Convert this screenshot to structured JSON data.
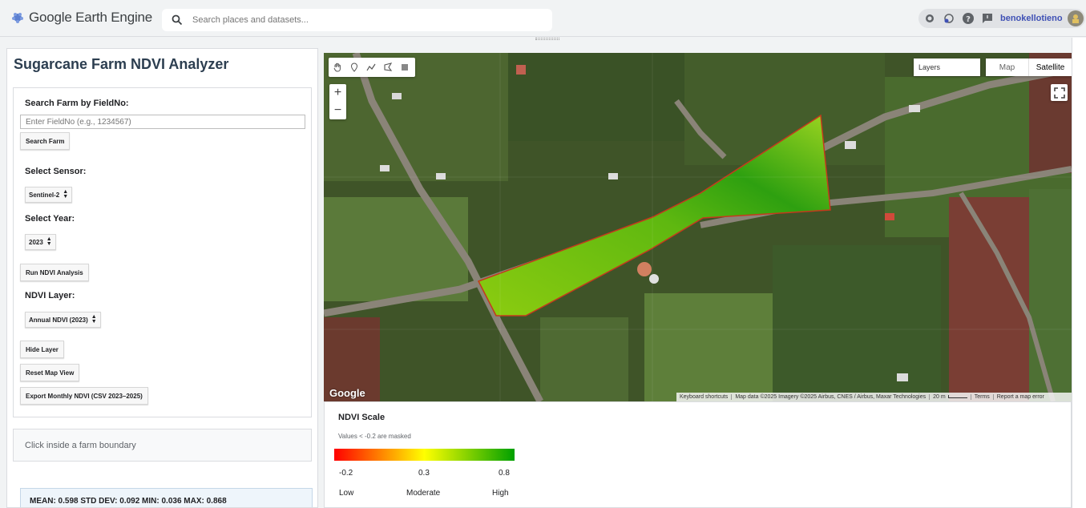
{
  "header": {
    "app_title": "Google Earth Engine",
    "search_placeholder": "Search places and datasets...",
    "username": "benokellotieno"
  },
  "panel": {
    "title": "Sugarcane Farm NDVI Analyzer",
    "search_label": "Search Farm by FieldNo:",
    "field_placeholder": "Enter FieldNo (e.g., 1234567)",
    "search_button": "Search Farm",
    "sensor_label": "Select Sensor:",
    "sensor_value": "Sentinel-2",
    "year_label": "Select Year:",
    "year_value": "2023",
    "run_button": "Run NDVI Analysis",
    "layer_label": "NDVI Layer:",
    "layer_value": "Annual NDVI (2023)",
    "hide_button": "Hide Layer",
    "reset_button": "Reset Map View",
    "export_button": "Export Monthly NDVI (CSV 2023–2025)",
    "inspector_text": "Click inside a farm boundary",
    "stats_text": "MEAN: 0.598   STD DEV: 0.092   MIN: 0.036   MAX: 0.868"
  },
  "map": {
    "layers_label": "Layers",
    "maptype_map": "Map",
    "maptype_satellite": "Satellite",
    "zoom_in": "+",
    "zoom_out": "−",
    "google_logo": "Google",
    "attribution": {
      "shortcuts": "Keyboard shortcuts",
      "data": "Map data ©2025 Imagery ©2025 Airbus, CNES / Airbus, Maxar Technologies",
      "scale": "20 m",
      "terms": "Terms",
      "report": "Report a map error"
    }
  },
  "legend": {
    "title": "NDVI Scale",
    "note": "Values < -0.2 are masked",
    "min": "-0.2",
    "mid": "0.3",
    "max": "0.8",
    "low": "Low",
    "moderate": "Moderate",
    "high": "High",
    "colors": [
      "#ff0000",
      "#ffff00",
      "#00a000"
    ]
  },
  "icons": [
    "gee-logo-icon",
    "search-icon",
    "brightness-icon",
    "notifications-icon",
    "help-icon",
    "feedback-icon",
    "hand-icon",
    "point-icon",
    "line-icon",
    "polygon-icon",
    "rectangle-icon",
    "fullscreen-icon"
  ]
}
